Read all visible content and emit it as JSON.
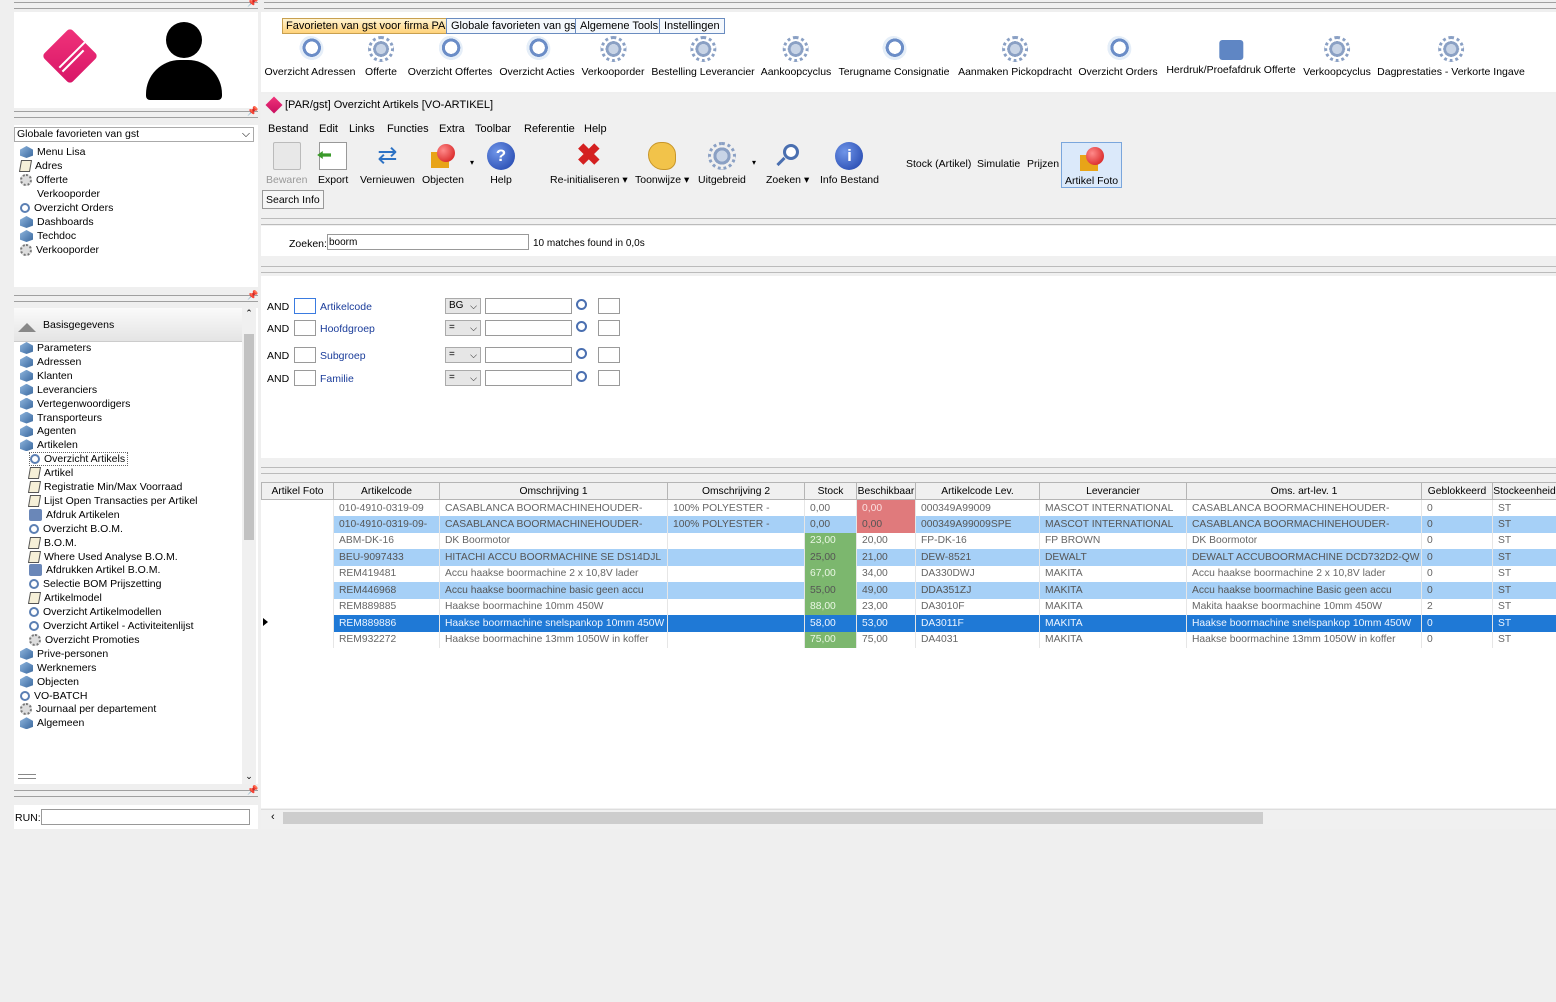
{
  "left": {
    "favorites_select": "Globale favorieten van gst",
    "fav_items": [
      {
        "label": "Menu Lisa",
        "icon": "book"
      },
      {
        "label": "Adres",
        "icon": "note"
      },
      {
        "label": "Offerte",
        "icon": "gear"
      },
      {
        "label": "Verkooporder",
        "icon": "none"
      },
      {
        "label": "Overzicht Orders",
        "icon": "mag"
      },
      {
        "label": "Dashboards",
        "icon": "book"
      },
      {
        "label": "Techdoc",
        "icon": "book"
      },
      {
        "label": "Verkooporder",
        "icon": "gear"
      }
    ],
    "section_title": "Basisgegevens",
    "tree": [
      {
        "label": "Parameters",
        "icon": "book",
        "indent": 0
      },
      {
        "label": "Adressen",
        "icon": "book",
        "indent": 0
      },
      {
        "label": "Klanten",
        "icon": "book",
        "indent": 0
      },
      {
        "label": "Leveranciers",
        "icon": "book",
        "indent": 0
      },
      {
        "label": "Vertegenwoordigers",
        "icon": "book",
        "indent": 0
      },
      {
        "label": "Transporteurs",
        "icon": "book",
        "indent": 0
      },
      {
        "label": "Agenten",
        "icon": "book",
        "indent": 0
      },
      {
        "label": "Artikelen",
        "icon": "book",
        "indent": 0
      },
      {
        "label": "Overzicht Artikels",
        "icon": "mag",
        "indent": 1
      },
      {
        "label": "Artikel",
        "icon": "note",
        "indent": 1
      },
      {
        "label": "Registratie Min/Max Voorraad",
        "icon": "note",
        "indent": 1
      },
      {
        "label": "Lijst Open Transacties per Artikel",
        "icon": "note",
        "indent": 1
      },
      {
        "label": "Afdruk Artikelen",
        "icon": "prt",
        "indent": 1
      },
      {
        "label": "Overzicht B.O.M.",
        "icon": "mag",
        "indent": 1
      },
      {
        "label": "B.O.M.",
        "icon": "note",
        "indent": 1
      },
      {
        "label": "Where Used Analyse B.O.M.",
        "icon": "note",
        "indent": 1
      },
      {
        "label": "Afdrukken Artikel B.O.M.",
        "icon": "prt",
        "indent": 1
      },
      {
        "label": "Selectie BOM Prijszetting",
        "icon": "mag",
        "indent": 1
      },
      {
        "label": "Artikelmodel",
        "icon": "note",
        "indent": 1
      },
      {
        "label": "Overzicht Artikelmodellen",
        "icon": "mag",
        "indent": 1
      },
      {
        "label": "Overzicht Artikel - Activiteitenlijst",
        "icon": "mag",
        "indent": 1
      },
      {
        "label": "Overzicht Promoties",
        "icon": "gear",
        "indent": 1
      },
      {
        "label": "Prive-personen",
        "icon": "book",
        "indent": 0
      },
      {
        "label": "Werknemers",
        "icon": "book",
        "indent": 0
      },
      {
        "label": "Objecten",
        "icon": "book",
        "indent": 0
      },
      {
        "label": "VO-BATCH",
        "icon": "mag",
        "indent": 0
      },
      {
        "label": "Journaal per departement",
        "icon": "gear",
        "indent": 0
      },
      {
        "label": "Algemeen",
        "icon": "book",
        "indent": 0
      }
    ],
    "run_label": "RUN:",
    "run_value": ""
  },
  "tabs": [
    "Favorieten van gst voor firma PAR",
    "Globale favorieten van gst",
    "Algemene Tools",
    "Instellingen"
  ],
  "favbar": [
    {
      "label": "Overzicht Adressen",
      "icon": "mag"
    },
    {
      "label": "Offerte",
      "icon": "gear"
    },
    {
      "label": "Overzicht Offertes",
      "icon": "mag"
    },
    {
      "label": "Overzicht Acties",
      "icon": "mag"
    },
    {
      "label": "Verkooporder",
      "icon": "gear"
    },
    {
      "label": "Bestelling Leverancier",
      "icon": "gear"
    },
    {
      "label": "Aankoopcyclus",
      "icon": "gear"
    },
    {
      "label": "Terugname Consignatie",
      "icon": "mag"
    },
    {
      "label": "Aanmaken Pickopdracht",
      "icon": "gear"
    },
    {
      "label": "Overzicht Orders",
      "icon": "mag"
    },
    {
      "label": "Herdruk/Proefafdruk Offerte",
      "icon": "printer"
    },
    {
      "label": "Verkoopcyclus",
      "icon": "gear"
    },
    {
      "label": "Dagprestaties - Verkorte Ingave",
      "icon": "gear"
    }
  ],
  "window_title": "[PAR/gst] Overzicht Artikels [VO-ARTIKEL]",
  "menubar": [
    "Bestand",
    "Edit",
    "Links",
    "Functies",
    "Extra",
    "Toolbar",
    "Referentie",
    "Help"
  ],
  "toolbar": {
    "bewaren": "Bewaren",
    "export": "Export",
    "vernieuwen": "Vernieuwen",
    "objecten": "Objecten",
    "help": "Help",
    "reinit": "Re-initialiseren",
    "toonwijze": "Toonwijze",
    "uitgebreid": "Uitgebreid",
    "zoeken": "Zoeken",
    "info": "Info Bestand",
    "stock": "Stock (Artikel)",
    "simulatie": "Simulatie",
    "prijzen": "Prijzen",
    "foto": "Artikel Foto",
    "search_info": "Search Info"
  },
  "search": {
    "label": "Zoeken:",
    "value": "boorm",
    "result": "10 matches found in 0,0s"
  },
  "filters": [
    {
      "op": "AND",
      "field": "Artikelcode",
      "cmp": "BG"
    },
    {
      "op": "AND",
      "field": "Hoofdgroep",
      "cmp": "="
    },
    {
      "op": "AND",
      "field": "Subgroep",
      "cmp": "="
    },
    {
      "op": "AND",
      "field": "Familie",
      "cmp": "="
    }
  ],
  "grid": {
    "columns": [
      "Artikel Foto",
      "Artikelcode",
      "Omschrijving 1",
      "Omschrijving 2",
      "Stock",
      "Beschikbaar",
      "Artikelcode Lev.",
      "Leverancier",
      "Oms. art-lev. 1",
      "Geblokkeerd",
      "Stockeenheid"
    ],
    "rows": [
      {
        "code": "010-4910-0319-09",
        "o1": "CASABLANCA BOORMACHINEHOUDER-",
        "o2": "100% POLYESTER -",
        "stock": "0,00",
        "besch": "0,00",
        "lev": "000349A99009",
        "leverancier": "MASCOT INTERNATIONAL",
        "oms": "CASABLANCA BOORMACHINEHOUDER-",
        "geb": "0",
        "eenh": "ST",
        "s": "",
        "b": "red",
        "style": ""
      },
      {
        "code": "010-4910-0319-09-",
        "o1": "CASABLANCA BOORMACHINEHOUDER-",
        "o2": "100% POLYESTER -",
        "stock": "0,00",
        "besch": "0,00",
        "lev": "000349A99009SPE",
        "leverancier": "MASCOT INTERNATIONAL",
        "oms": "CASABLANCA BOORMACHINEHOUDER-",
        "geb": "0",
        "eenh": "ST",
        "s": "",
        "b": "red",
        "style": "alt"
      },
      {
        "code": "ABM-DK-16",
        "o1": "DK Boormotor",
        "o2": "",
        "stock": "23,00",
        "besch": "20,00",
        "lev": "FP-DK-16",
        "leverancier": "FP BROWN",
        "oms": "DK Boormotor",
        "geb": "0",
        "eenh": "ST",
        "s": "green",
        "b": "",
        "style": ""
      },
      {
        "code": "BEU-9097433",
        "o1": "HITACHI ACCU BOORMACHINE SE DS14DJL",
        "o2": "",
        "stock": "25,00",
        "besch": "21,00",
        "lev": "DEW-8521",
        "leverancier": "DEWALT",
        "oms": "DEWALT ACCUBOORMACHINE DCD732D2-QW",
        "geb": "0",
        "eenh": "ST",
        "s": "green",
        "b": "",
        "style": "alt"
      },
      {
        "code": "REM419481",
        "o1": "Accu haakse boormachine 2 x 10,8V lader",
        "o2": "",
        "stock": "67,00",
        "besch": "34,00",
        "lev": "DA330DWJ",
        "leverancier": "MAKITA",
        "oms": "Accu haakse boormachine 2 x 10,8V lader",
        "geb": "0",
        "eenh": "ST",
        "s": "green",
        "b": "",
        "style": ""
      },
      {
        "code": "REM446968",
        "o1": "Accu haakse boormachine basic geen accu",
        "o2": "",
        "stock": "55,00",
        "besch": "49,00",
        "lev": "DDA351ZJ",
        "leverancier": "MAKITA",
        "oms": "Accu haakse boormachine Basic geen accu",
        "geb": "0",
        "eenh": "ST",
        "s": "green",
        "b": "",
        "style": "alt"
      },
      {
        "code": "REM889885",
        "o1": "Haakse boormachine  10mm 450W",
        "o2": "",
        "stock": "88,00",
        "besch": "23,00",
        "lev": "DA3010F",
        "leverancier": "MAKITA",
        "oms": "Makita haakse boormachine  10mm 450W",
        "geb": "2",
        "eenh": "ST",
        "s": "green",
        "b": "",
        "style": ""
      },
      {
        "code": "REM889886",
        "o1": "Haakse boormachine snelspankop 10mm 450W",
        "o2": "",
        "stock": "58,00",
        "besch": "53,00",
        "lev": "DA3011F",
        "leverancier": "MAKITA",
        "oms": "Haakse boormachine snelspankop 10mm 450W",
        "geb": "0",
        "eenh": "ST",
        "s": "",
        "b": "",
        "style": "cur"
      },
      {
        "code": "REM932272",
        "o1": "Haakse boormachine 13mm 1050W in koffer",
        "o2": "",
        "stock": "75,00",
        "besch": "75,00",
        "lev": "DA4031",
        "leverancier": "MAKITA",
        "oms": "Haakse boormachine 13mm 1050W in koffer",
        "geb": "0",
        "eenh": "ST",
        "s": "green",
        "b": "",
        "style": ""
      }
    ]
  }
}
